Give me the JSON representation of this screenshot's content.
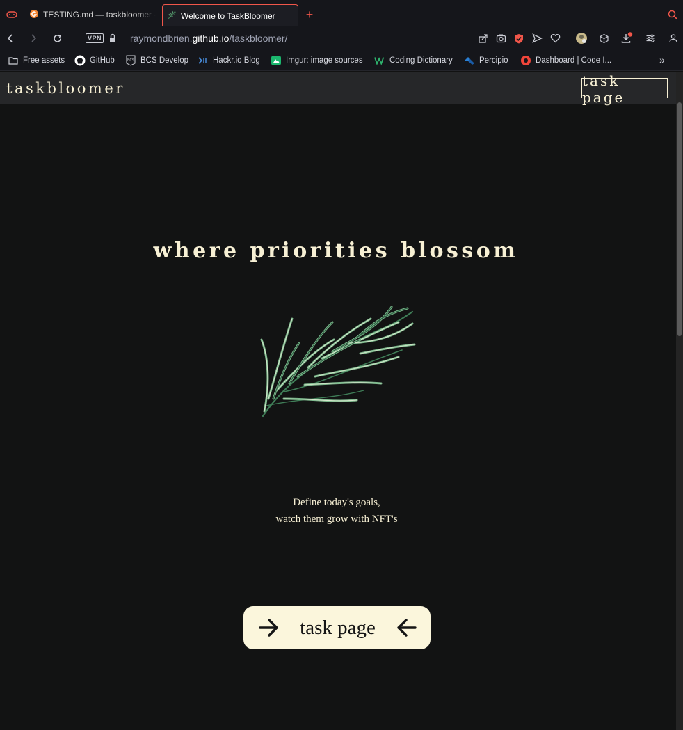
{
  "browser": {
    "tabs": [
      {
        "title": "TESTING.md — taskbloomer — "
      },
      {
        "title": "Welcome to TaskBloomer"
      }
    ],
    "vpn_label": "VPN",
    "url": {
      "host_prefix": "raymondbrien.",
      "host_main": "github.io",
      "path": "/taskbloomer/"
    },
    "bookmarks": [
      {
        "label": "Free assets",
        "icon": "folder-icon"
      },
      {
        "label": "GitHub",
        "icon": "github-icon"
      },
      {
        "label": "BCS Develop",
        "icon": "bcs-icon"
      },
      {
        "label": "Hackr.io Blog",
        "icon": "hackr-icon"
      },
      {
        "label": "Imgur: image sources",
        "icon": "imgur-icon"
      },
      {
        "label": "Coding Dictionary",
        "icon": "w-icon"
      },
      {
        "label": "Percipio",
        "icon": "percipio-icon"
      },
      {
        "label": "Dashboard | Code I...",
        "icon": "dashboard-icon"
      }
    ],
    "accent_color": "#f0564a"
  },
  "site": {
    "brand": "taskbloomer",
    "nav_link": "task page",
    "hero_title": "where priorities blossom",
    "tagline_line1": "Define today's goals,",
    "tagline_line2": "watch them grow with NFT's",
    "cta_label": "task page",
    "cream_color": "#fbf6dc",
    "background_color": "#121313"
  }
}
